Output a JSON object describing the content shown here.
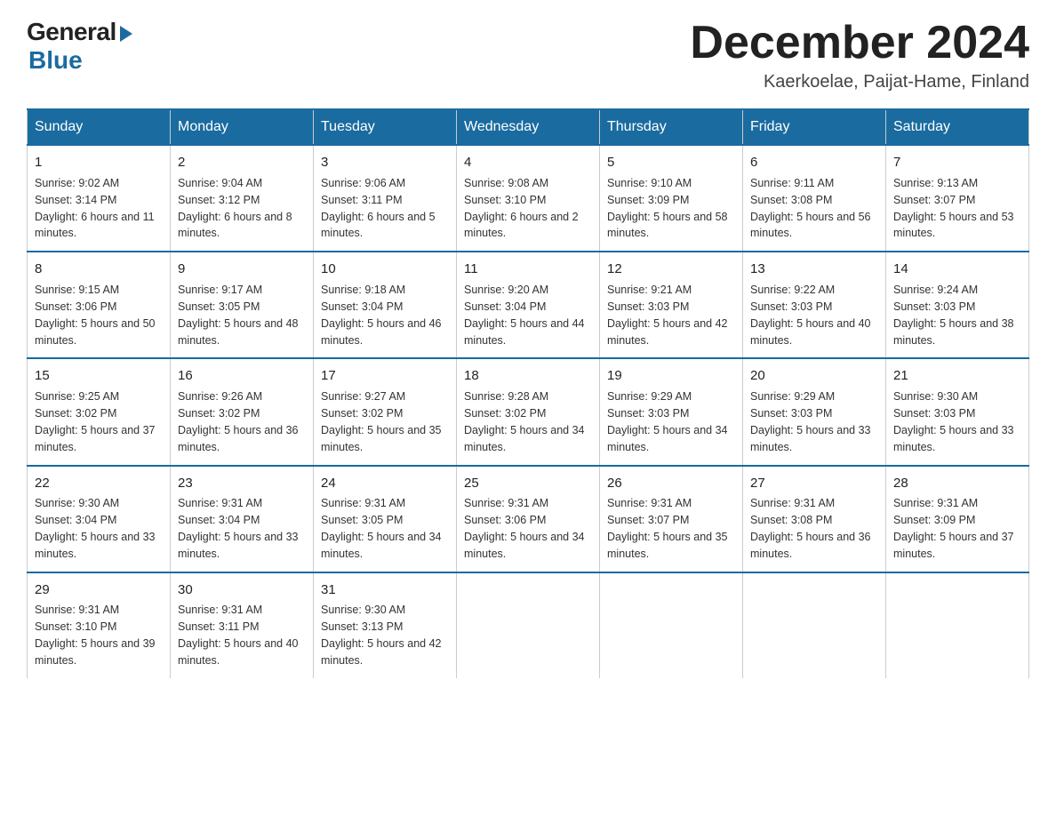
{
  "header": {
    "logo": {
      "general": "General",
      "blue": "Blue"
    },
    "title": "December 2024",
    "location": "Kaerkoelae, Paijat-Hame, Finland"
  },
  "calendar": {
    "days_of_week": [
      "Sunday",
      "Monday",
      "Tuesday",
      "Wednesday",
      "Thursday",
      "Friday",
      "Saturday"
    ],
    "weeks": [
      [
        {
          "day": "1",
          "sunrise": "9:02 AM",
          "sunset": "3:14 PM",
          "daylight": "6 hours and 11 minutes."
        },
        {
          "day": "2",
          "sunrise": "9:04 AM",
          "sunset": "3:12 PM",
          "daylight": "6 hours and 8 minutes."
        },
        {
          "day": "3",
          "sunrise": "9:06 AM",
          "sunset": "3:11 PM",
          "daylight": "6 hours and 5 minutes."
        },
        {
          "day": "4",
          "sunrise": "9:08 AM",
          "sunset": "3:10 PM",
          "daylight": "6 hours and 2 minutes."
        },
        {
          "day": "5",
          "sunrise": "9:10 AM",
          "sunset": "3:09 PM",
          "daylight": "5 hours and 58 minutes."
        },
        {
          "day": "6",
          "sunrise": "9:11 AM",
          "sunset": "3:08 PM",
          "daylight": "5 hours and 56 minutes."
        },
        {
          "day": "7",
          "sunrise": "9:13 AM",
          "sunset": "3:07 PM",
          "daylight": "5 hours and 53 minutes."
        }
      ],
      [
        {
          "day": "8",
          "sunrise": "9:15 AM",
          "sunset": "3:06 PM",
          "daylight": "5 hours and 50 minutes."
        },
        {
          "day": "9",
          "sunrise": "9:17 AM",
          "sunset": "3:05 PM",
          "daylight": "5 hours and 48 minutes."
        },
        {
          "day": "10",
          "sunrise": "9:18 AM",
          "sunset": "3:04 PM",
          "daylight": "5 hours and 46 minutes."
        },
        {
          "day": "11",
          "sunrise": "9:20 AM",
          "sunset": "3:04 PM",
          "daylight": "5 hours and 44 minutes."
        },
        {
          "day": "12",
          "sunrise": "9:21 AM",
          "sunset": "3:03 PM",
          "daylight": "5 hours and 42 minutes."
        },
        {
          "day": "13",
          "sunrise": "9:22 AM",
          "sunset": "3:03 PM",
          "daylight": "5 hours and 40 minutes."
        },
        {
          "day": "14",
          "sunrise": "9:24 AM",
          "sunset": "3:03 PM",
          "daylight": "5 hours and 38 minutes."
        }
      ],
      [
        {
          "day": "15",
          "sunrise": "9:25 AM",
          "sunset": "3:02 PM",
          "daylight": "5 hours and 37 minutes."
        },
        {
          "day": "16",
          "sunrise": "9:26 AM",
          "sunset": "3:02 PM",
          "daylight": "5 hours and 36 minutes."
        },
        {
          "day": "17",
          "sunrise": "9:27 AM",
          "sunset": "3:02 PM",
          "daylight": "5 hours and 35 minutes."
        },
        {
          "day": "18",
          "sunrise": "9:28 AM",
          "sunset": "3:02 PM",
          "daylight": "5 hours and 34 minutes."
        },
        {
          "day": "19",
          "sunrise": "9:29 AM",
          "sunset": "3:03 PM",
          "daylight": "5 hours and 34 minutes."
        },
        {
          "day": "20",
          "sunrise": "9:29 AM",
          "sunset": "3:03 PM",
          "daylight": "5 hours and 33 minutes."
        },
        {
          "day": "21",
          "sunrise": "9:30 AM",
          "sunset": "3:03 PM",
          "daylight": "5 hours and 33 minutes."
        }
      ],
      [
        {
          "day": "22",
          "sunrise": "9:30 AM",
          "sunset": "3:04 PM",
          "daylight": "5 hours and 33 minutes."
        },
        {
          "day": "23",
          "sunrise": "9:31 AM",
          "sunset": "3:04 PM",
          "daylight": "5 hours and 33 minutes."
        },
        {
          "day": "24",
          "sunrise": "9:31 AM",
          "sunset": "3:05 PM",
          "daylight": "5 hours and 34 minutes."
        },
        {
          "day": "25",
          "sunrise": "9:31 AM",
          "sunset": "3:06 PM",
          "daylight": "5 hours and 34 minutes."
        },
        {
          "day": "26",
          "sunrise": "9:31 AM",
          "sunset": "3:07 PM",
          "daylight": "5 hours and 35 minutes."
        },
        {
          "day": "27",
          "sunrise": "9:31 AM",
          "sunset": "3:08 PM",
          "daylight": "5 hours and 36 minutes."
        },
        {
          "day": "28",
          "sunrise": "9:31 AM",
          "sunset": "3:09 PM",
          "daylight": "5 hours and 37 minutes."
        }
      ],
      [
        {
          "day": "29",
          "sunrise": "9:31 AM",
          "sunset": "3:10 PM",
          "daylight": "5 hours and 39 minutes."
        },
        {
          "day": "30",
          "sunrise": "9:31 AM",
          "sunset": "3:11 PM",
          "daylight": "5 hours and 40 minutes."
        },
        {
          "day": "31",
          "sunrise": "9:30 AM",
          "sunset": "3:13 PM",
          "daylight": "5 hours and 42 minutes."
        },
        null,
        null,
        null,
        null
      ]
    ]
  }
}
